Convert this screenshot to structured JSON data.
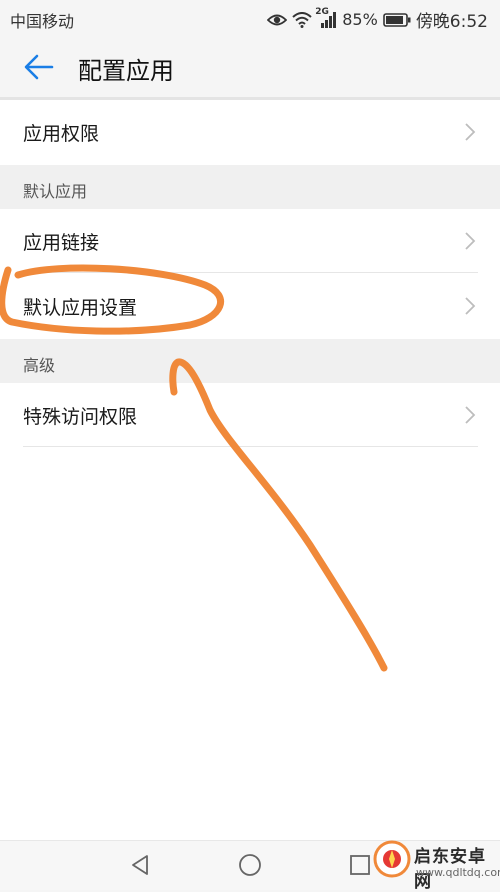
{
  "status_bar": {
    "carrier": "中国移动",
    "network": "2G",
    "battery": "85%",
    "time": "傍晚6:52"
  },
  "header": {
    "back_icon": "arrow-left-icon",
    "title": "配置应用"
  },
  "rows": [
    {
      "label": "应用权限"
    },
    {
      "label": "应用链接"
    },
    {
      "label": "默认应用设置"
    },
    {
      "label": "特殊访问权限"
    }
  ],
  "sections": [
    {
      "label": "默认应用"
    },
    {
      "label": "高级"
    }
  ],
  "nav_bar": {
    "back": "triangle-back-icon",
    "home": "circle-home-icon",
    "recent": "square-recent-icon"
  },
  "watermark": {
    "title": "启东安卓网",
    "url": "www.qdltdq.com"
  },
  "colors": {
    "accent": "#1a7ee6",
    "annotation": "#f0893a"
  }
}
